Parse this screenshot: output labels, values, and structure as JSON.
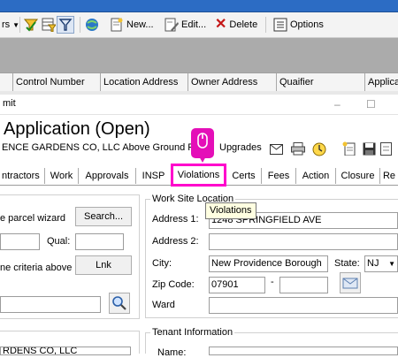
{
  "toolbar": {
    "left_fragment": "rs",
    "new_label": "New...",
    "edit_label": "Edit...",
    "delete_label": "Delete",
    "options_label": "Options"
  },
  "grid": {
    "columns": [
      "Control Number",
      "Location Address",
      "Owner Address",
      "Quaifier",
      "Applica"
    ]
  },
  "dialog": {
    "title_fragment": "mit",
    "app_title": "Application (Open)",
    "subtitle": "ENCE GARDENS CO, LLC Above Ground Po",
    "subtitle_tail": "Upgrades"
  },
  "tabs": [
    "ntractors",
    "Work",
    "Approvals",
    "INSP",
    "Violations",
    "Certs",
    "Fees",
    "Action",
    "Closure",
    "Re"
  ],
  "tooltip": "Violations",
  "left_panel": {
    "wizard_label": "e parcel wizard",
    "search_button": "Search...",
    "qual_label": "Qual:",
    "criteria_label": "ne criteria above",
    "link_button": "Lnk",
    "bottom_text": "RDENS CO, LLC"
  },
  "work_site": {
    "legend": "Work Site Location",
    "address1_label": "Address 1:",
    "address1_value": "1248 SPRINGFIELD AVE",
    "address2_label": "Address 2:",
    "address2_value": "",
    "city_label": "City:",
    "city_value": "New Providence Borough",
    "state_label": "State:",
    "state_value": "NJ",
    "zip_label": "Zip Code:",
    "zip_value": "07901",
    "zip_sep": "-",
    "ward_label": "Ward"
  },
  "tenant": {
    "legend": "Tenant Information",
    "name_label": "Name:"
  },
  "colors": {
    "highlight": "#ff00cc",
    "title_bar": "#2c6cc4"
  }
}
